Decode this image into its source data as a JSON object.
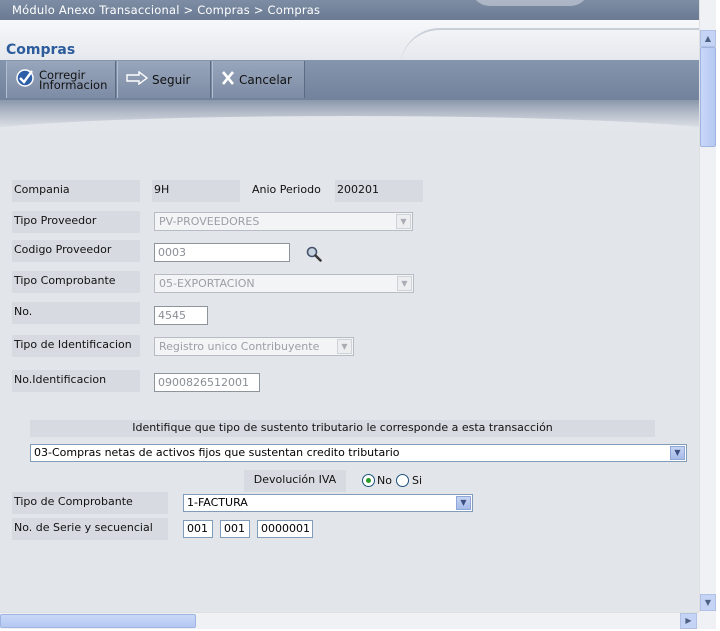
{
  "breadcrumb": "Módulo Anexo Transaccional > Compras > Compras",
  "page_title": "Compras",
  "toolbar": {
    "corregir_line1": "Corregir",
    "corregir_line2": "Informacion",
    "seguir": "Seguir",
    "cancelar": "Cancelar"
  },
  "icons": {
    "corregir": "check-circle-icon",
    "seguir": "arrow-right-icon",
    "cancelar": "x-icon",
    "buscar": "magnifier-icon"
  },
  "form": {
    "compania_label": "Compania",
    "compania_value": "9H",
    "anio_label": "Anio Periodo",
    "anio_value": "200201",
    "tipo_proveedor_label": "Tipo Proveedor",
    "tipo_proveedor_value": "PV-PROVEEDORES",
    "codigo_proveedor_label": "Codigo Proveedor",
    "codigo_proveedor_value": "0003",
    "tipo_comprobante_label": "Tipo Comprobante",
    "tipo_comprobante_value": "05-EXPORTACION",
    "no_label": "No.",
    "no_value": "4545",
    "tipo_identificacion_label": "Tipo de Identificacion",
    "tipo_identificacion_value": "Registro unico Contribuyente",
    "no_identificacion_label": "No.Identificacion",
    "no_identificacion_value": "0900826512001",
    "sustento_prompt": "Identifique que tipo de sustento tributario le corresponde a esta transacción",
    "sustento_value": "03-Compras netas de activos fijos que sustentan credito tributario",
    "devolucion_label": "Devolución IVA",
    "radio_no": "No",
    "radio_si": "Si",
    "tipo_de_comprobante_label": "Tipo de Comprobante",
    "tipo_de_comprobante_value": "1-FACTURA",
    "serie_label": "No. de Serie y secuencial",
    "serie_1": "001",
    "serie_2": "001",
    "secuencial": "0000001"
  },
  "colors": {
    "title": "#2c5c9c",
    "toolbar": "#7d8ca5",
    "form_bg": "#e2e5e9",
    "label_bg": "#d7dbe1"
  }
}
